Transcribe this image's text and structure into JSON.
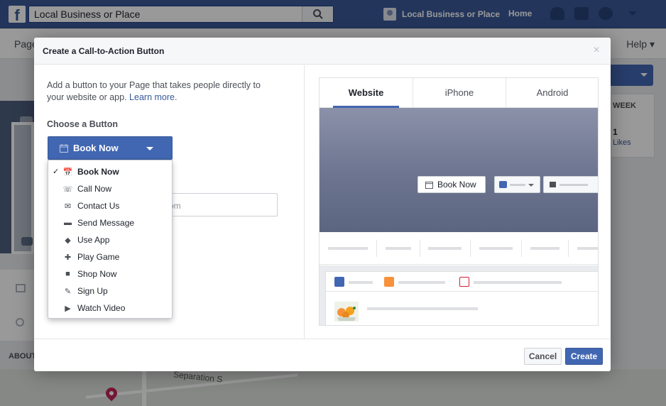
{
  "topbar": {
    "search_placeholder": "Local Business or Place",
    "page_name": "Local Business or Place",
    "home_label": "Home",
    "brand_color": "#3b5998"
  },
  "background": {
    "subnav_left": "Page",
    "subnav_help": "Help",
    "week_label": "WEEK",
    "week_number": "1",
    "likes_label": "Likes",
    "about_label": "ABOUT",
    "map_street": "Separation S"
  },
  "dialog": {
    "title": "Create a Call-to-Action Button",
    "close_glyph": "×",
    "intro_text": "Add a button to your Page that takes people directly to your website or app.",
    "learn_more": "Learn more.",
    "choose_label": "Choose a Button",
    "selected_button": "Book Now",
    "url_input_visible_suffix": "om",
    "dropdown": {
      "items": [
        {
          "label": "Book Now",
          "icon": "calendar-icon",
          "glyph": "📅",
          "selected": true
        },
        {
          "label": "Call Now",
          "icon": "phone-icon",
          "glyph": "☏",
          "selected": false
        },
        {
          "label": "Contact Us",
          "icon": "envelope-icon",
          "glyph": "✉",
          "selected": false
        },
        {
          "label": "Send Message",
          "icon": "chat-bubble-icon",
          "glyph": "▬",
          "selected": false
        },
        {
          "label": "Use App",
          "icon": "cube-icon",
          "glyph": "◆",
          "selected": false
        },
        {
          "label": "Play Game",
          "icon": "game-controller-icon",
          "glyph": "✚",
          "selected": false
        },
        {
          "label": "Shop Now",
          "icon": "shopping-bag-icon",
          "glyph": "■",
          "selected": false
        },
        {
          "label": "Sign Up",
          "icon": "pencil-icon",
          "glyph": "✎",
          "selected": false
        },
        {
          "label": "Watch Video",
          "icon": "video-icon",
          "glyph": "▶",
          "selected": false
        }
      ],
      "check_glyph": "✓"
    },
    "preview": {
      "tabs": [
        "Website",
        "iPhone",
        "Android"
      ],
      "active_tab": "Website",
      "preview_button_label": "Book Now"
    },
    "footer": {
      "cancel_label": "Cancel",
      "create_label": "Create"
    }
  },
  "colors": {
    "accent": "#4267b2",
    "link": "#365899"
  }
}
